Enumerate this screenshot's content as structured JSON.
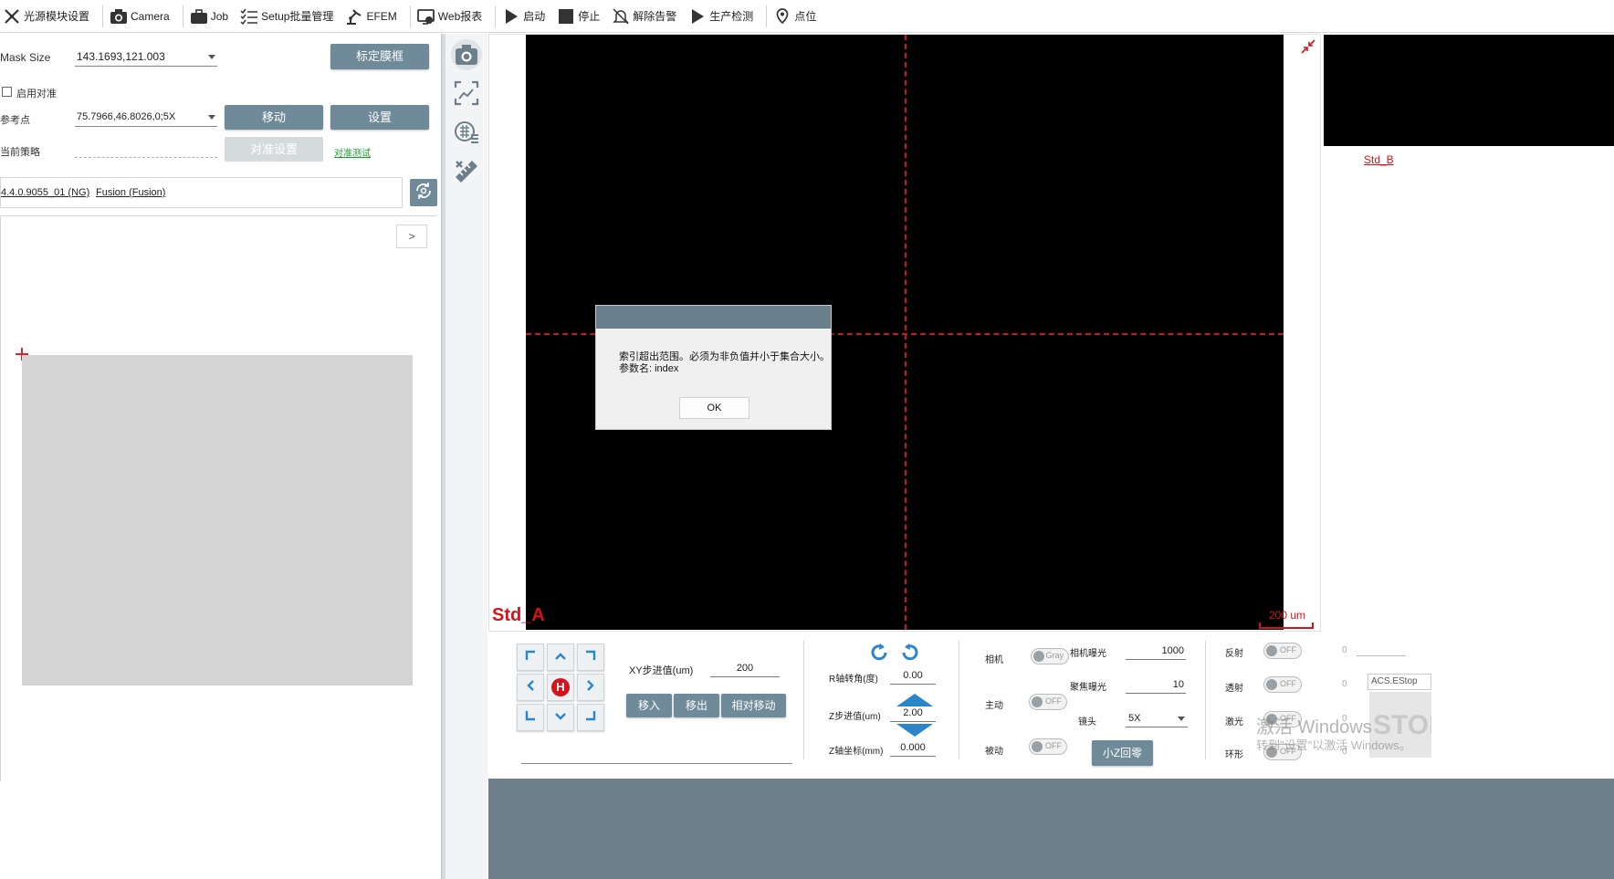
{
  "toolbar": {
    "items": [
      {
        "label": "光源模块设置",
        "icon": "light-module-icon"
      },
      {
        "label": "Camera",
        "icon": "camera-icon"
      },
      {
        "label": "Job",
        "icon": "briefcase-icon"
      },
      {
        "label": "Setup批量管理",
        "icon": "checklist-icon"
      },
      {
        "label": "EFEM",
        "icon": "robot-arm-icon"
      },
      {
        "label": "Web报表",
        "icon": "web-report-icon"
      },
      {
        "label": "启动",
        "icon": "play-icon"
      },
      {
        "label": "停止",
        "icon": "stop-icon"
      },
      {
        "label": "解除告警",
        "icon": "bell-off-icon"
      },
      {
        "label": "生产检测",
        "icon": "play-icon"
      },
      {
        "label": "点位",
        "icon": "location-pin-icon"
      }
    ]
  },
  "left": {
    "mask_size_label": "Mask Size",
    "mask_size_value": "143.1693,121.003",
    "calibrate_button": "标定膜框",
    "enable_align_label": "启用对准",
    "ref_point_label": "参考点",
    "ref_point_value": "75.7966,46.8026,0;5X",
    "move_button": "移动",
    "set_button": "设置",
    "current_strategy_label": "当前策略",
    "align_settings_button": "对准设置",
    "align_test_link": "对准测试",
    "recipe_name": "4.4.0.9055_01 (NG)",
    "recipe_fusion": "Fusion (Fusion)",
    "expand_button": ">"
  },
  "view": {
    "camera_label": "Std_A",
    "scale_label": "200 um",
    "secondary_label": "Std_B"
  },
  "dialog": {
    "message_line1": "索引超出范围。必须为非负值并小于集合大小。",
    "message_line2": "参数名: index",
    "ok_button": "OK"
  },
  "controls": {
    "home_label": "H",
    "xy_step_label": "XY步进值(um)",
    "xy_step_value": "200",
    "move_in_button": "移入",
    "move_out_button": "移出",
    "relative_move_button": "相对移动",
    "r_axis_label": "R轴转角(度)",
    "r_axis_value": "0.00",
    "z_step_label": "Z步进值(um)",
    "z_step_value": "2.00",
    "z_coord_label": "Z轴坐标(mm)",
    "z_coord_value": "0.000",
    "camera_label": "相机",
    "camera_toggle": "Gray",
    "active_label": "主动",
    "active_toggle": "OFF",
    "passive_label": "被动",
    "passive_toggle": "OFF",
    "camera_exposure_label": "相机曝光",
    "camera_exposure_value": "1000",
    "focus_exposure_label": "聚焦曝光",
    "focus_exposure_value": "10",
    "lens_label": "镜头",
    "lens_value": "5X",
    "small_z_home_button": "小Z回零",
    "reflect_label": "反射",
    "reflect_toggle": "OFF",
    "reflect_value": "0",
    "transmit_label": "透射",
    "transmit_toggle": "OFF",
    "transmit_value": "0",
    "laser_label": "激光",
    "laser_toggle": "OFF",
    "laser_value": "0",
    "ring_label": "环形",
    "ring_toggle": "OFF",
    "ring_value": "0",
    "estop_label": "ACS.EStop",
    "estop_text": "STOP"
  },
  "watermark": {
    "line1": "激活 Windows",
    "line2": "转到\"设置\"以激活 Windows。"
  },
  "colors": {
    "accent_gray_blue": "#6f8a99",
    "crosshair_red": "#d4131a",
    "label_red": "#d4131a"
  }
}
